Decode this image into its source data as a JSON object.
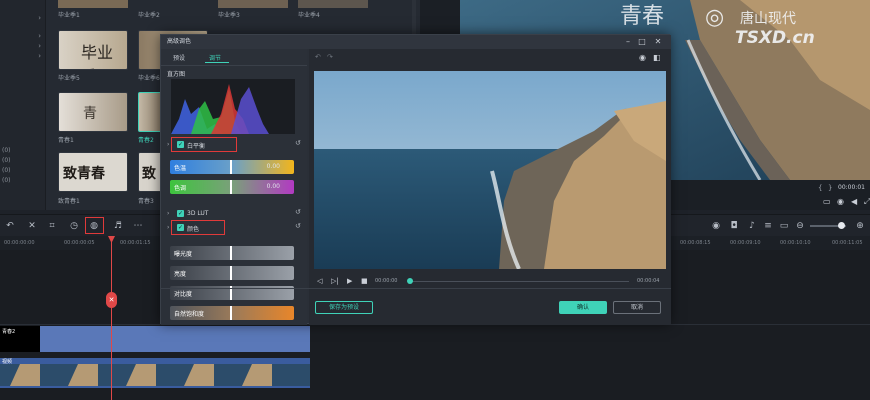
{
  "library": {
    "sidebar_items": [
      "",
      "",
      "",
      "",
      "(0)",
      "(0)",
      "(0)",
      "(0)"
    ],
    "captions": [
      "毕业季1",
      "毕业季2",
      "毕业季3",
      "毕业季4",
      "毕业季5",
      "毕业季6",
      "青春1",
      "青春2",
      "青春3",
      "致青春1"
    ],
    "thumb_text": [
      "毕业季",
      "青",
      "致青春",
      "致"
    ]
  },
  "preview": {
    "watermark": "唐山现代",
    "watermark_sub": "TSXD.cn",
    "overlay_text": "青春",
    "time_right": "00:00:01",
    "bracket_left": "{",
    "bracket_right": "}"
  },
  "toolbar": {
    "undo": "↶",
    "redo": "↷",
    "delete": "✕",
    "crop": "⌗",
    "speed": "◷",
    "color": "◍",
    "audio": "♬",
    "more": "⋯"
  },
  "ruler": {
    "times_left": [
      "00:00:00:00",
      "00:00:00:05",
      "00:00:01:15"
    ],
    "times_right": [
      "00:00:08:15",
      "00:00:09:10",
      "00:00:10:10",
      "00:00:11:05"
    ]
  },
  "tracks": {
    "title_label": "青春2",
    "video_label": "视频"
  },
  "dialog": {
    "title": "高级调色",
    "tabs": [
      "预设",
      "调节"
    ],
    "histogram_label": "直方图",
    "white_balance": "白平衡",
    "temperature_label": "色温",
    "temperature_value": "0.00",
    "tint_label": "色调",
    "tint_value": "0.00",
    "lut_label": "3D LUT",
    "color_label": "颜色",
    "exposure_label": "曝光度",
    "brightness_label": "亮度",
    "contrast_label": "对比度",
    "vibrance_label": "自然饱和度",
    "time_current": "00:00:00",
    "time_total": "00:00:04",
    "save_preset": "保存为预设",
    "ok": "确认",
    "cancel": "取消",
    "colors": {
      "accent": "#3fd2b8",
      "temperature_gradient_start": "#2f7fe0",
      "temperature_gradient_end": "#f2b51c",
      "tint_gradient_start": "#3ec43e",
      "tint_gradient_end": "#b23ac2",
      "vibrance": "#e8862a",
      "highlight_box": "#e03a3a"
    }
  }
}
